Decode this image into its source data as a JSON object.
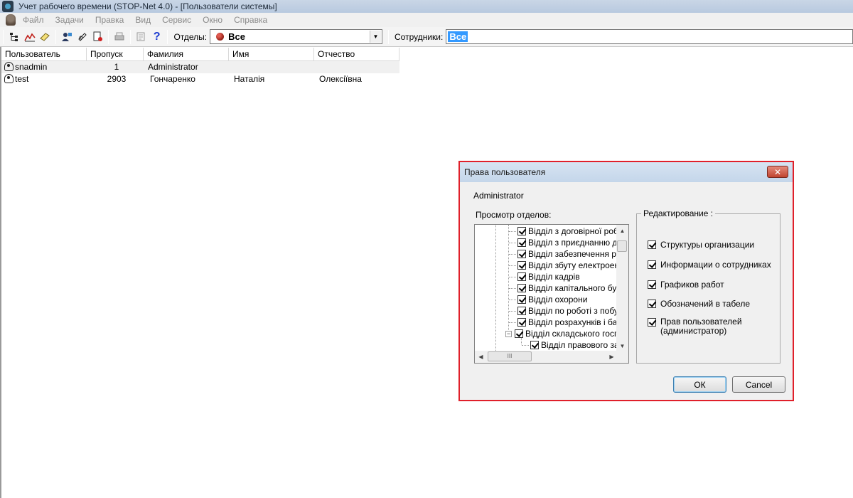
{
  "window": {
    "title": "Учет рабочего времени (STOP-Net 4.0) - [Пользователи системы]"
  },
  "menu": [
    "Файл",
    "Задачи",
    "Правка",
    "Вид",
    "Сервис",
    "Окно",
    "Справка"
  ],
  "toolbar": {
    "dept_label": "Отделы:",
    "dept_value": "Все",
    "emp_label": "Сотрудники:",
    "emp_value": "Все"
  },
  "table": {
    "headers": [
      "Пользователь",
      "Пропуск",
      "Фамилия",
      "Имя",
      "Отчество"
    ],
    "rows": [
      {
        "user": "snadmin",
        "pass": "1",
        "surname": "Administrator",
        "name": "",
        "patronymic": ""
      },
      {
        "user": "test",
        "pass": "2903",
        "surname": "Гончаренко",
        "name": "Наталія",
        "patronymic": "Олексіївна"
      }
    ]
  },
  "dialog": {
    "title": "Права пользователя",
    "close": "✕",
    "username": "Administrator",
    "tree_label": "Просмотр отделов:",
    "tree_items": [
      "Відділ з договірної роботи",
      "Відділ з приєднанню до БЕ",
      "Відділ забезпечення роз",
      "Відділ збуту електроене",
      "Відділ кадрів",
      "Відділ капітального будів",
      "Відділ охорони",
      "Відділ по роботі з побуто",
      "Відділ розрахунків і бала",
      "Відділ складського госп",
      "Відділ правового заб"
    ],
    "scroll_thumb_grip": "III",
    "group_label": "Редактирование :",
    "options": [
      "Структуры организации",
      "Информации о сотрудниках",
      "Графиков работ",
      "Обозначений в табеле",
      "Прав пользователей (администратор)"
    ],
    "ok": "ОК",
    "cancel": "Cancel"
  },
  "icons": {
    "toolbar": [
      "tree-icon",
      "chart-icon",
      "note-icon",
      "users-icon",
      "clock-icon",
      "report-icon",
      "print-icon",
      "export-icon",
      "help-icon"
    ]
  }
}
